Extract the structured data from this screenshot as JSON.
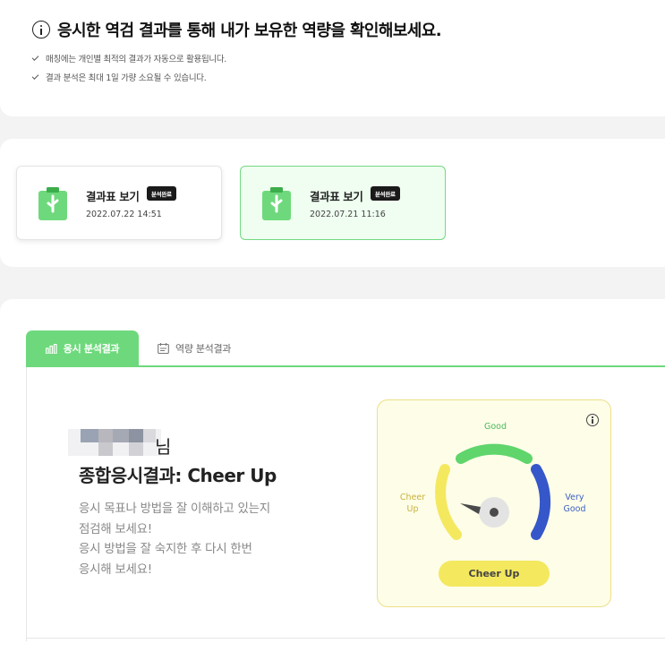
{
  "notice": {
    "title": "응시한 역검 결과를 통해 내가 보유한 역량을 확인해보세요.",
    "items": [
      "매칭에는 개인별 최적의 결과가 자동으로 활용됩니다.",
      "결과 분석은 최대 1일 가량 소요될 수 있습니다."
    ]
  },
  "results": [
    {
      "title": "결과표 보기",
      "badge": "분석완료",
      "date": "2022.07.22 14:51",
      "selected": false
    },
    {
      "title": "결과표 보기",
      "badge": "분석완료",
      "date": "2022.07.21 11:16",
      "selected": true
    }
  ],
  "tabs": [
    {
      "label": "응시 분석결과",
      "icon": "bar-chart-icon",
      "active": true
    },
    {
      "label": "역량 분석결과",
      "icon": "calendar-icon",
      "active": false
    }
  ],
  "analysis": {
    "name_suffix": "님",
    "overall_title": "종합응시결과: Cheer Up",
    "description": [
      "응시 목표나 방법을 잘 이해하고 있는지",
      "점검해 보세요!",
      "응시 방법을 잘 숙지한 후 다시 한번",
      "응시해 보세요!"
    ]
  },
  "gauge": {
    "label_good": "Good",
    "label_cheer_up": "Cheer\nUp",
    "label_very_good": "Very\nGood",
    "result": "Cheer Up",
    "colors": {
      "cheer_up": "#f4e85f",
      "good": "#5fd56c",
      "very_good": "#3557c9"
    },
    "info_icon": "info-icon"
  },
  "colors": {
    "accent": "#6ed97c",
    "badge": "#1a1a1a"
  }
}
